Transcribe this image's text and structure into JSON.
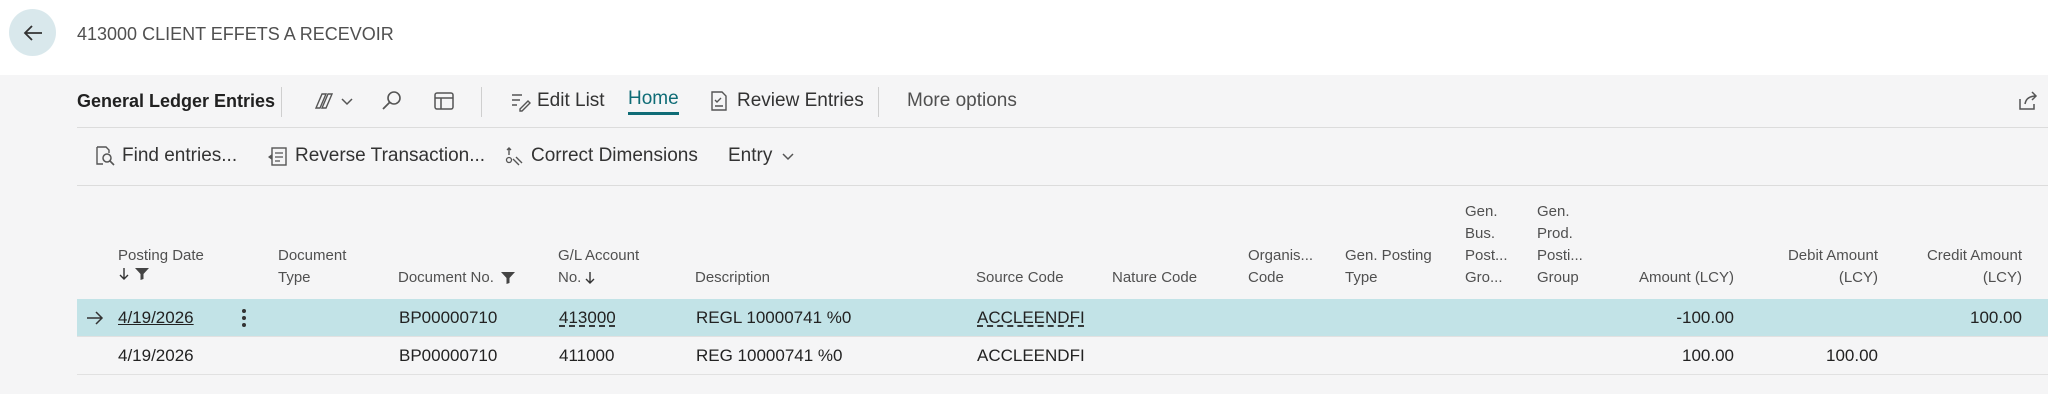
{
  "header": {
    "title": "413000 CLIENT EFFETS A RECEVOIR"
  },
  "actionbar": {
    "page_name": "General Ledger Entries",
    "edit_list": "Edit List",
    "home": "Home",
    "review_entries": "Review Entries",
    "more_options": "More options"
  },
  "subbar": {
    "find_entries": "Find entries...",
    "reverse_transaction": "Reverse Transaction...",
    "correct_dimensions": "Correct Dimensions",
    "entry": "Entry"
  },
  "table": {
    "columns": {
      "posting_date": "Posting Date",
      "document_type_1": "Document",
      "document_type_2": "Type",
      "document_no": "Document No.",
      "gl_account_1": "G/L Account",
      "gl_account_2": "No.",
      "description": "Description",
      "source_code": "Source Code",
      "nature_code": "Nature Code",
      "organis_1": "Organis...",
      "organis_2": "Code",
      "gen_posting_1": "Gen. Posting",
      "gen_posting_2": "Type",
      "gen_bus_1": "Gen.",
      "gen_bus_2": "Bus.",
      "gen_bus_3": "Post...",
      "gen_bus_4": "Gro...",
      "gen_prod_1": "Gen.",
      "gen_prod_2": "Prod.",
      "gen_prod_3": "Posti...",
      "gen_prod_4": "Group",
      "amount": "Amount (LCY)",
      "debit_1": "Debit Amount",
      "debit_2": "(LCY)",
      "credit_1": "Credit Amount",
      "credit_2": "(LCY)"
    },
    "rows": [
      {
        "posting_date": "4/19/2026",
        "document_no": "BP00000710",
        "gl_account": "413000",
        "description": "REGL 10000741 %0",
        "source_code": "ACCLEENDFI",
        "amount": "-100.00",
        "debit": "",
        "credit": "100.00"
      },
      {
        "posting_date": "4/19/2026",
        "document_no": "BP00000710",
        "gl_account": "411000",
        "description": "REG 10000741 %0",
        "source_code": "ACCLEENDFI",
        "amount": "100.00",
        "debit": "100.00",
        "credit": ""
      }
    ]
  },
  "colors": {
    "accent": "#0f6c76",
    "selected_row": "#c2e3e7",
    "back_button_bg": "#d9e8ec"
  }
}
